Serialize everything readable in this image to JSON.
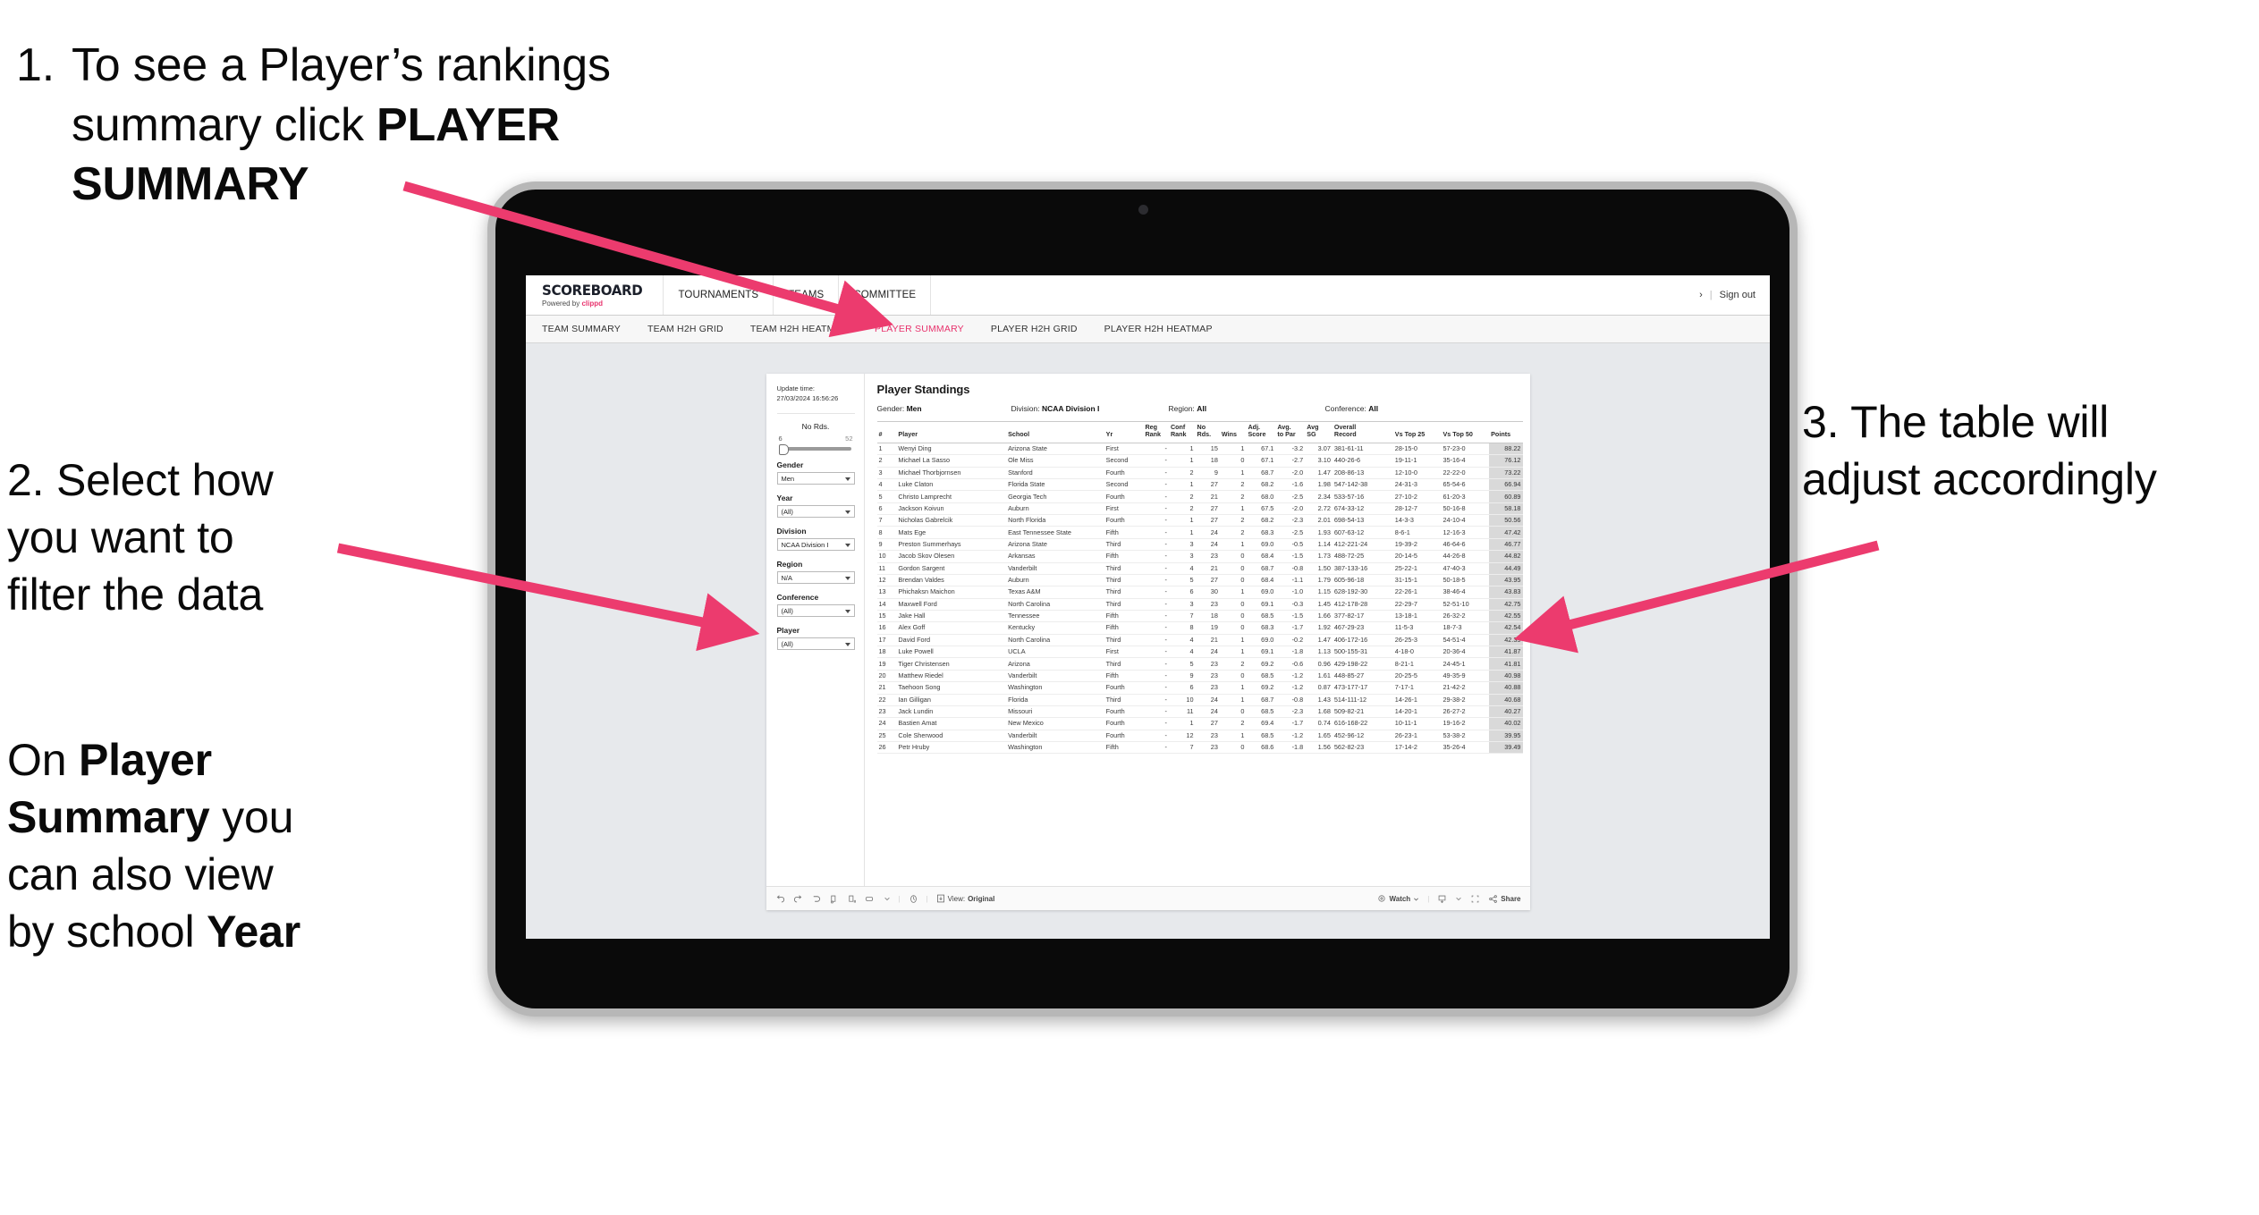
{
  "annotations": {
    "step1": {
      "number": "1.",
      "line1": "To see a Player’s rankings",
      "line2a": "summary click ",
      "line2b": "PLAYER",
      "line3b": "SUMMARY"
    },
    "step2": {
      "line1": "2. Select how",
      "line2": "you want to",
      "line3": "filter the data",
      "p2_l1a": "On ",
      "p2_l1b": "Player",
      "p2_l2a": "Summary",
      "p2_l2b": " you",
      "p2_l3": "can also view",
      "p2_l4a": "by school ",
      "p2_l4b": "Year"
    },
    "step3": {
      "line1": "3. The table will",
      "line2": "adjust accordingly"
    }
  },
  "accent_pink": "#ec3b6e",
  "app": {
    "brand": {
      "name": "SCOREBOARD",
      "powered_prefix": "Powered by ",
      "powered_brand": "clippd"
    },
    "topnav": [
      "TOURNAMENTS",
      "TEAMS",
      "COMMITTEE"
    ],
    "header_right": {
      "user_glyph": "›",
      "divider": "|",
      "sign_out": "Sign out"
    },
    "subnav": {
      "items": [
        {
          "label": "TEAM SUMMARY",
          "active": false
        },
        {
          "label": "TEAM H2H GRID",
          "active": false
        },
        {
          "label": "TEAM H2H HEATMAP",
          "active": false
        },
        {
          "label": "PLAYER SUMMARY",
          "active": true
        },
        {
          "label": "PLAYER H2H GRID",
          "active": false
        },
        {
          "label": "PLAYER H2H HEATMAP",
          "active": false
        }
      ]
    }
  },
  "filters": {
    "update_time_label": "Update time:",
    "update_time_value": "27/03/2024 16:56:26",
    "slider": {
      "title": "No Rds.",
      "min": "6",
      "max": "52",
      "value_pct": 4
    },
    "groups": [
      {
        "label": "Gender",
        "value": "Men"
      },
      {
        "label": "Year",
        "value": "(All)"
      },
      {
        "label": "Division",
        "value": "NCAA Division I"
      },
      {
        "label": "Region",
        "value": "N/A"
      },
      {
        "label": "Conference",
        "value": "(All)"
      },
      {
        "label": "Player",
        "value": "(All)"
      }
    ]
  },
  "viz": {
    "title": "Player Standings",
    "summary": [
      {
        "label": "Gender:",
        "value": "Men"
      },
      {
        "label": "Division:",
        "value": "NCAA Division I"
      },
      {
        "label": "Region:",
        "value": "All"
      },
      {
        "label": "Conference:",
        "value": "All"
      }
    ],
    "toolbar": {
      "view_label": "View:",
      "view_value": "Original",
      "watch": "Watch",
      "share": "Share"
    }
  },
  "chart_data": {
    "type": "table",
    "title": "Player Standings",
    "columns": [
      "#",
      "Player",
      "School",
      "Yr",
      "Reg Rank",
      "Conf Rank",
      "No Rds.",
      "Wins",
      "Adj. Score",
      "Avg. to Par",
      "Avg SG",
      "Overall Record",
      "Vs Top 25",
      "Vs Top 50",
      "Points"
    ],
    "rows": [
      [
        "1",
        "Wenyi Ding",
        "Arizona State",
        "First",
        "-",
        "1",
        "15",
        "1",
        "67.1",
        "-3.2",
        "3.07",
        "381-61-11",
        "28-15-0",
        "57-23-0",
        "88.22"
      ],
      [
        "2",
        "Michael La Sasso",
        "Ole Miss",
        "Second",
        "-",
        "1",
        "18",
        "0",
        "67.1",
        "-2.7",
        "3.10",
        "440-26-6",
        "19-11-1",
        "35-16-4",
        "76.12"
      ],
      [
        "3",
        "Michael Thorbjornsen",
        "Stanford",
        "Fourth",
        "-",
        "2",
        "9",
        "1",
        "68.7",
        "-2.0",
        "1.47",
        "208-86-13",
        "12-10-0",
        "22-22-0",
        "73.22"
      ],
      [
        "4",
        "Luke Claton",
        "Florida State",
        "Second",
        "-",
        "1",
        "27",
        "2",
        "68.2",
        "-1.6",
        "1.98",
        "547-142-38",
        "24-31-3",
        "65-54-6",
        "66.94"
      ],
      [
        "5",
        "Christo Lamprecht",
        "Georgia Tech",
        "Fourth",
        "-",
        "2",
        "21",
        "2",
        "68.0",
        "-2.5",
        "2.34",
        "533-57-16",
        "27-10-2",
        "61-20-3",
        "60.89"
      ],
      [
        "6",
        "Jackson Koivun",
        "Auburn",
        "First",
        "-",
        "2",
        "27",
        "1",
        "67.5",
        "-2.0",
        "2.72",
        "674-33-12",
        "28-12-7",
        "50-16-8",
        "58.18"
      ],
      [
        "7",
        "Nicholas Gabrelcik",
        "North Florida",
        "Fourth",
        "-",
        "1",
        "27",
        "2",
        "68.2",
        "-2.3",
        "2.01",
        "698-54-13",
        "14-3-3",
        "24-10-4",
        "50.56"
      ],
      [
        "8",
        "Mats Ege",
        "East Tennessee State",
        "Fifth",
        "-",
        "1",
        "24",
        "2",
        "68.3",
        "-2.5",
        "1.93",
        "607-63-12",
        "8-6-1",
        "12-16-3",
        "47.42"
      ],
      [
        "9",
        "Preston Summerhays",
        "Arizona State",
        "Third",
        "-",
        "3",
        "24",
        "1",
        "69.0",
        "-0.5",
        "1.14",
        "412-221-24",
        "19-39-2",
        "46-64-6",
        "46.77"
      ],
      [
        "10",
        "Jacob Skov Olesen",
        "Arkansas",
        "Fifth",
        "-",
        "3",
        "23",
        "0",
        "68.4",
        "-1.5",
        "1.73",
        "488-72-25",
        "20-14-5",
        "44-26-8",
        "44.82"
      ],
      [
        "11",
        "Gordon Sargent",
        "Vanderbilt",
        "Third",
        "-",
        "4",
        "21",
        "0",
        "68.7",
        "-0.8",
        "1.50",
        "387-133-16",
        "25-22-1",
        "47-40-3",
        "44.49"
      ],
      [
        "12",
        "Brendan Valdes",
        "Auburn",
        "Third",
        "-",
        "5",
        "27",
        "0",
        "68.4",
        "-1.1",
        "1.79",
        "605-96-18",
        "31-15-1",
        "50-18-5",
        "43.95"
      ],
      [
        "13",
        "Phichaksn Maichon",
        "Texas A&M",
        "Third",
        "-",
        "6",
        "30",
        "1",
        "69.0",
        "-1.0",
        "1.15",
        "628-192-30",
        "22-26-1",
        "38-46-4",
        "43.83"
      ],
      [
        "14",
        "Maxwell Ford",
        "North Carolina",
        "Third",
        "-",
        "3",
        "23",
        "0",
        "69.1",
        "-0.3",
        "1.45",
        "412-178-28",
        "22-29-7",
        "52-51-10",
        "42.75"
      ],
      [
        "15",
        "Jake Hall",
        "Tennessee",
        "Fifth",
        "-",
        "7",
        "18",
        "0",
        "68.5",
        "-1.5",
        "1.66",
        "377-82-17",
        "13-18-1",
        "26-32-2",
        "42.55"
      ],
      [
        "16",
        "Alex Goff",
        "Kentucky",
        "Fifth",
        "-",
        "8",
        "19",
        "0",
        "68.3",
        "-1.7",
        "1.92",
        "467-29-23",
        "11-5-3",
        "18-7-3",
        "42.54"
      ],
      [
        "17",
        "David Ford",
        "North Carolina",
        "Third",
        "-",
        "4",
        "21",
        "1",
        "69.0",
        "-0.2",
        "1.47",
        "406-172-16",
        "26-25-3",
        "54-51-4",
        "42.35"
      ],
      [
        "18",
        "Luke Powell",
        "UCLA",
        "First",
        "-",
        "4",
        "24",
        "1",
        "69.1",
        "-1.8",
        "1.13",
        "500-155-31",
        "4-18-0",
        "20-36-4",
        "41.87"
      ],
      [
        "19",
        "Tiger Christensen",
        "Arizona",
        "Third",
        "-",
        "5",
        "23",
        "2",
        "69.2",
        "-0.6",
        "0.96",
        "429-198-22",
        "8-21-1",
        "24-45-1",
        "41.81"
      ],
      [
        "20",
        "Matthew Riedel",
        "Vanderbilt",
        "Fifth",
        "-",
        "9",
        "23",
        "0",
        "68.5",
        "-1.2",
        "1.61",
        "448-85-27",
        "20-25-5",
        "49-35-9",
        "40.98"
      ],
      [
        "21",
        "Taehoon Song",
        "Washington",
        "Fourth",
        "-",
        "6",
        "23",
        "1",
        "69.2",
        "-1.2",
        "0.87",
        "473-177-17",
        "7-17-1",
        "21-42-2",
        "40.88"
      ],
      [
        "22",
        "Ian Gilligan",
        "Florida",
        "Third",
        "-",
        "10",
        "24",
        "1",
        "68.7",
        "-0.8",
        "1.43",
        "514-111-12",
        "14-26-1",
        "29-38-2",
        "40.68"
      ],
      [
        "23",
        "Jack Lundin",
        "Missouri",
        "Fourth",
        "-",
        "11",
        "24",
        "0",
        "68.5",
        "-2.3",
        "1.68",
        "509-82-21",
        "14-20-1",
        "26-27-2",
        "40.27"
      ],
      [
        "24",
        "Bastien Amat",
        "New Mexico",
        "Fourth",
        "-",
        "1",
        "27",
        "2",
        "69.4",
        "-1.7",
        "0.74",
        "616-168-22",
        "10-11-1",
        "19-16-2",
        "40.02"
      ],
      [
        "25",
        "Cole Sherwood",
        "Vanderbilt",
        "Fourth",
        "-",
        "12",
        "23",
        "1",
        "68.5",
        "-1.2",
        "1.65",
        "452-96-12",
        "26-23-1",
        "53-38-2",
        "39.95"
      ],
      [
        "26",
        "Petr Hruby",
        "Washington",
        "Fifth",
        "-",
        "7",
        "23",
        "0",
        "68.6",
        "-1.8",
        "1.56",
        "562-82-23",
        "17-14-2",
        "35-26-4",
        "39.49"
      ]
    ],
    "header_groups": [
      {
        "line1": "#",
        "line2": ""
      },
      {
        "line1": "Player",
        "line2": ""
      },
      {
        "line1": "School",
        "line2": ""
      },
      {
        "line1": "Yr",
        "line2": ""
      },
      {
        "line1": "Reg",
        "line2": "Rank"
      },
      {
        "line1": "Conf",
        "line2": "Rank"
      },
      {
        "line1": "No",
        "line2": "Rds."
      },
      {
        "line1": "Wins",
        "line2": ""
      },
      {
        "line1": "Adj.",
        "line2": "Score"
      },
      {
        "line1": "Avg.",
        "line2": "to Par"
      },
      {
        "line1": "Avg",
        "line2": "SG"
      },
      {
        "line1": "Overall",
        "line2": "Record"
      },
      {
        "line1": "Vs Top 25",
        "line2": ""
      },
      {
        "line1": "Vs Top 50",
        "line2": ""
      },
      {
        "line1": "Points",
        "line2": ""
      }
    ]
  }
}
